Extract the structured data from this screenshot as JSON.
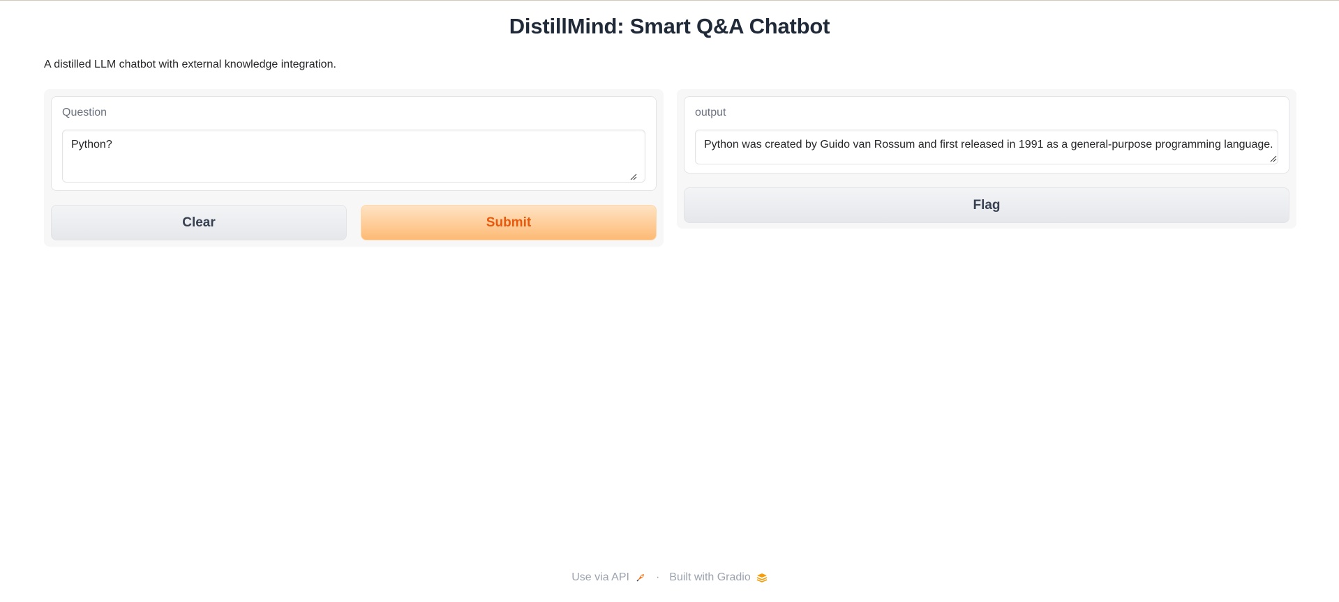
{
  "header": {
    "title": "DistillMind: Smart Q&A Chatbot",
    "description": "A distilled LLM chatbot with external knowledge integration."
  },
  "input_panel": {
    "question_label": "Question",
    "question_value": "Python?",
    "clear_label": "Clear",
    "submit_label": "Submit"
  },
  "output_panel": {
    "output_label": "output",
    "output_value": "Python was created by Guido van Rossum and first released in 1991 as a general-purpose programming language.",
    "flag_label": "Flag"
  },
  "footer": {
    "api_link": "Use via API",
    "api_icon": "rocket-icon",
    "separator": "·",
    "built_with": "Built with Gradio",
    "gradio_icon": "gradio-logo-icon"
  },
  "colors": {
    "primary_button_text": "#ea580c",
    "primary_button_bg": "#fdba74",
    "footer_text": "#9ca3af"
  }
}
